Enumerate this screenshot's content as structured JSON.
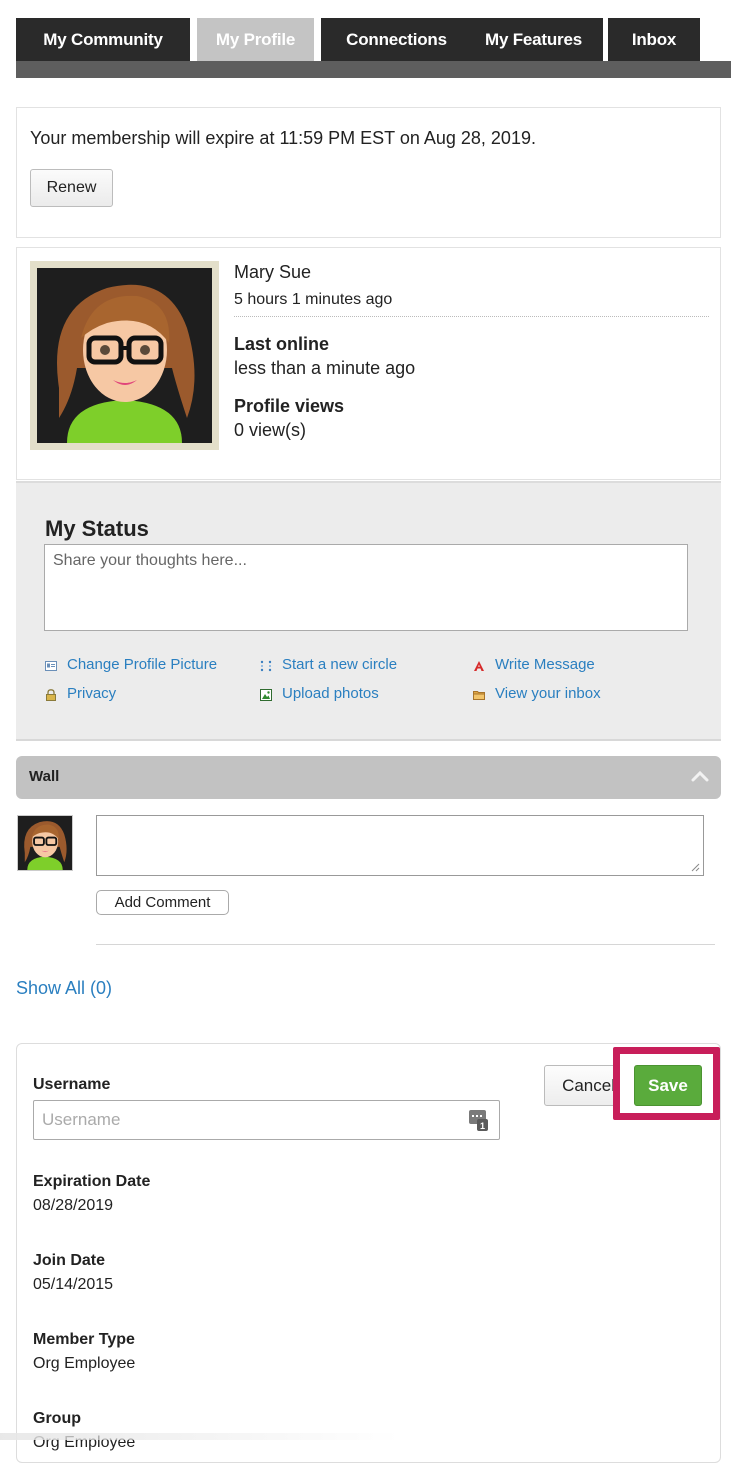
{
  "tabs": [
    {
      "label": "My Community",
      "active": false
    },
    {
      "label": "My Profile",
      "active": true
    },
    {
      "label": "Connections",
      "active": false
    },
    {
      "label": "My Features",
      "active": false
    },
    {
      "label": "Inbox",
      "active": false
    }
  ],
  "membership": {
    "notice": "Your membership will expire at 11:59 PM EST on Aug 28, 2019.",
    "renew_label": "Renew"
  },
  "profile": {
    "name": "Mary Sue",
    "updated": "5 hours 1 minutes ago",
    "last_online_label": "Last online",
    "last_online_value": "less than a minute ago",
    "profile_views_label": "Profile views",
    "profile_views_value": "0 view(s)"
  },
  "status": {
    "title": "My Status",
    "placeholder": "Share your thoughts here...",
    "links": [
      {
        "label": "Change Profile Picture",
        "icon": "id-card-icon"
      },
      {
        "label": "Start a new circle",
        "icon": "circle-dots-icon"
      },
      {
        "label": "Write Message",
        "icon": "write-message-icon"
      },
      {
        "label": "Privacy",
        "icon": "lock-icon"
      },
      {
        "label": "Upload photos",
        "icon": "photo-icon"
      },
      {
        "label": "View your inbox",
        "icon": "folder-icon"
      }
    ]
  },
  "wall": {
    "title": "Wall",
    "add_comment_label": "Add Comment",
    "show_all_label": "Show All (0)"
  },
  "form": {
    "username_label": "Username",
    "username_placeholder": "Username",
    "cancel_label": "Cancel",
    "save_label": "Save",
    "expiration_label": "Expiration Date",
    "expiration_value": "08/28/2019",
    "join_label": "Join Date",
    "join_value": "05/14/2015",
    "member_type_label": "Member Type",
    "member_type_value": "Org Employee",
    "group_label": "Group",
    "group_value": "Org Employee"
  },
  "colors": {
    "link": "#2a7fc0",
    "save_button": "#5aab3c",
    "highlight": "#c81e5a",
    "tab_dark": "#2a2a2a",
    "tab_active": "#c4c4c4"
  }
}
